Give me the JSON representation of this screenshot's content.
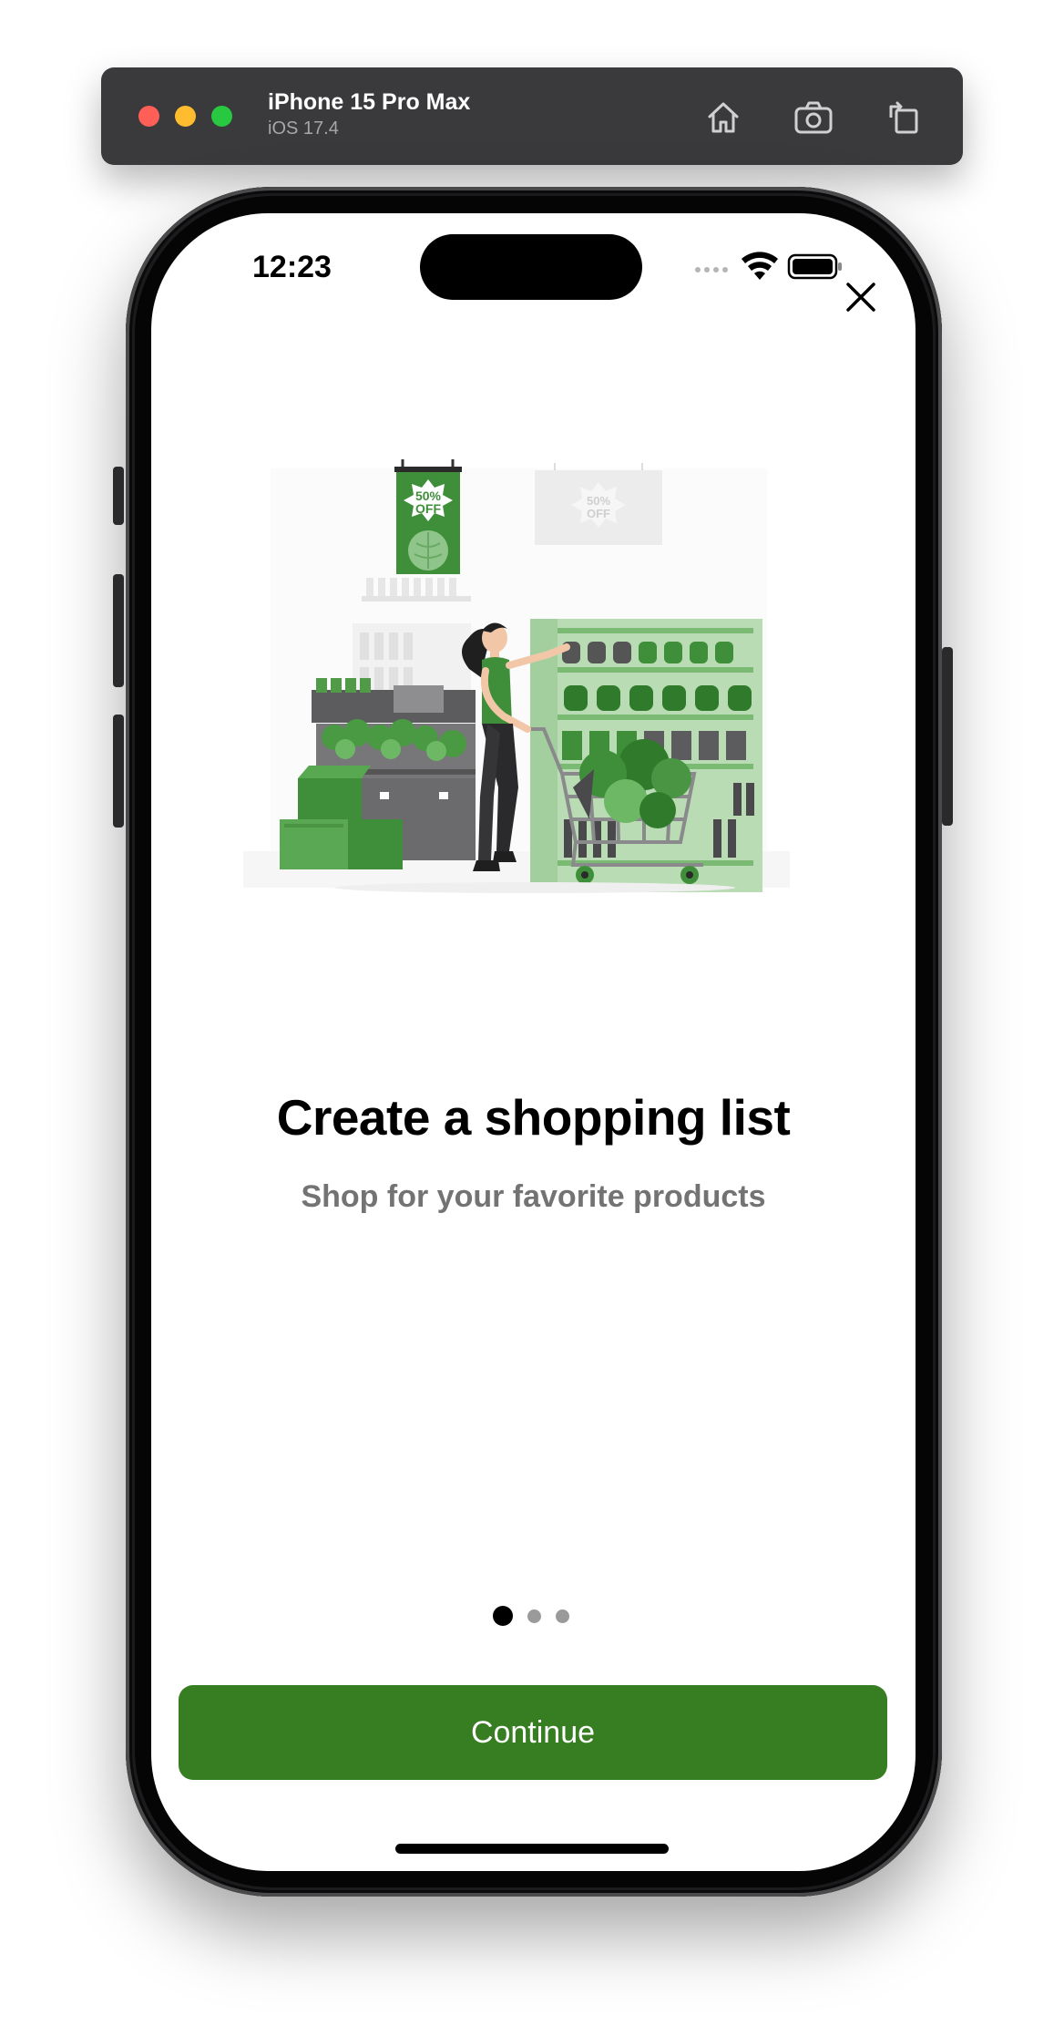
{
  "simulator": {
    "device_name": "iPhone 15 Pro Max",
    "os_version": "iOS 17.4",
    "buttons": [
      "home-icon",
      "screenshot-icon",
      "rotate-icon"
    ]
  },
  "status_bar": {
    "time": "12:23",
    "icons": [
      "cellular-icon",
      "wifi-icon",
      "battery-icon"
    ]
  },
  "onboarding": {
    "close_icon": "close-icon",
    "illustration": {
      "description_icon": "shopping-illustration",
      "sign_text_1": "50%",
      "sign_text_2": "OFF"
    },
    "title": "Create a shopping list",
    "subtitle": "Shop for your favorite products",
    "page_indicator": {
      "count": 3,
      "current": 1
    },
    "continue_label": "Continue"
  },
  "colors": {
    "accent": "#377e22",
    "illustration_green": "#3f8f3a",
    "illustration_light_green": "#b9dcb5",
    "subtitle_gray": "#737373"
  }
}
